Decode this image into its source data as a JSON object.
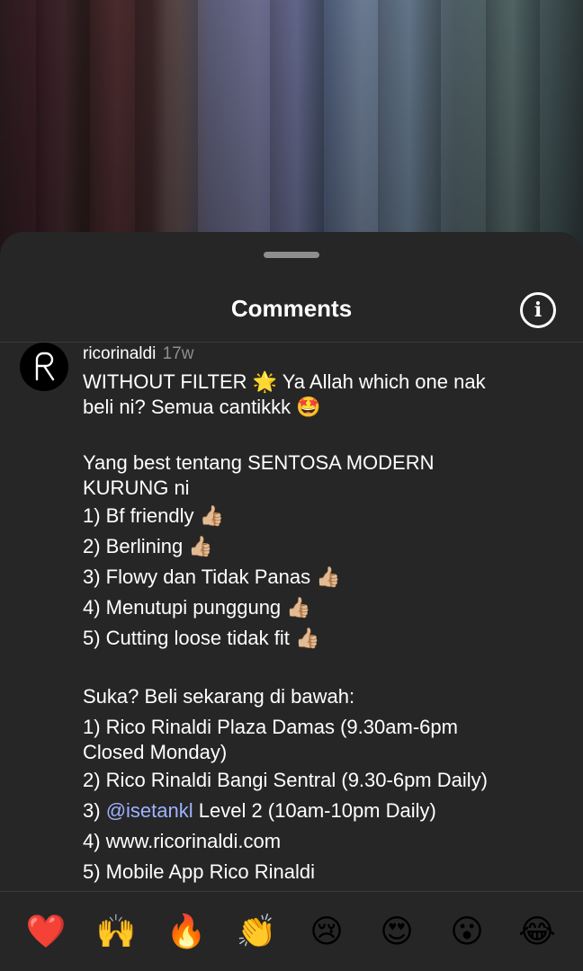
{
  "sheet": {
    "title": "Comments",
    "info_icon": "i"
  },
  "comment": {
    "username": "ricorinaldi",
    "time": "17w",
    "avatar_letter": "R",
    "line1": "WITHOUT FILTER 🌟 Ya Allah which one nak",
    "line2": "beli ni? Semua cantikkk 🤩",
    "line3": "Yang best tentang SENTOSA MODERN",
    "line4": "KURUNG ni",
    "features": [
      "1) Bf friendly 👍🏼",
      "2) Berlining 👍🏼",
      "3) Flowy dan Tidak Panas 👍🏼",
      "4) Menutupi punggung 👍🏼",
      "5) Cutting loose tidak fit 👍🏼"
    ],
    "buy_heading": "Suka? Beli sekarang di bawah:",
    "store1_a": "1) Rico Rinaldi Plaza Damas (9.30am-6pm",
    "store1_b": "Closed Monday)",
    "store2": "2) Rico Rinaldi Bangi Sentral (9.30-6pm Daily)",
    "store3_prefix": "3) ",
    "store3_mention": "@isetankl",
    "store3_suffix": " Level 2 (10am-10pm Daily)",
    "store4": "4) www.ricorinaldi.com",
    "store5": "5) Mobile App Rico Rinaldi"
  },
  "emoji_bar": [
    "❤️",
    "🙌",
    "🔥",
    "👏",
    "😢",
    "😍",
    "😮",
    "😂"
  ]
}
